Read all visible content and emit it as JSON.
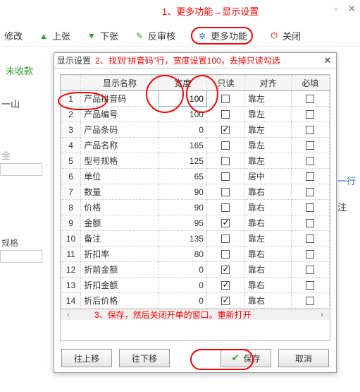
{
  "annotations": {
    "note1": "1、更多功能→显示设置",
    "note2": "2、找到“拼音码”行，宽度设置100，去掉只读勾选",
    "note3": "3、保存，然后关闭开单的窗口。重新打开"
  },
  "titlebar": {
    "min_glyph": "▫",
    "close_glyph": "✕"
  },
  "toolbar": {
    "edit": "修改",
    "prev": "上张",
    "next": "下张",
    "unaudit": "反审核",
    "more": "更多功能",
    "close": "关闭"
  },
  "background": {
    "unpaid": "未收款",
    "yishan": "一山",
    "jin": "金",
    "guige": "规格",
    "xing": "一行",
    "zhu": "注"
  },
  "dialog": {
    "title": "显示设置",
    "headers": {
      "name": "显示名称",
      "width": "宽度",
      "readonly": "只读",
      "align": "对齐",
      "required": "必填"
    },
    "rows": [
      {
        "name": "产品拼音码",
        "width": "100",
        "readonly": false,
        "align": "靠左",
        "required": false,
        "editing": true
      },
      {
        "name": "产品编号",
        "width": "100",
        "readonly": false,
        "align": "靠左",
        "required": false
      },
      {
        "name": "产品条码",
        "width": "0",
        "readonly": true,
        "align": "靠左",
        "required": false
      },
      {
        "name": "产品名称",
        "width": "165",
        "readonly": false,
        "align": "靠左",
        "required": false
      },
      {
        "name": "型号规格",
        "width": "125",
        "readonly": false,
        "align": "靠左",
        "required": false
      },
      {
        "name": "单位",
        "width": "65",
        "readonly": false,
        "align": "居中",
        "required": false
      },
      {
        "name": "数量",
        "width": "90",
        "readonly": false,
        "align": "靠右",
        "required": false
      },
      {
        "name": "价格",
        "width": "90",
        "readonly": false,
        "align": "靠右",
        "required": false
      },
      {
        "name": "金额",
        "width": "95",
        "readonly": true,
        "align": "靠右",
        "required": false
      },
      {
        "name": "备注",
        "width": "135",
        "readonly": false,
        "align": "靠左",
        "required": false
      },
      {
        "name": "折扣率",
        "width": "80",
        "readonly": false,
        "align": "靠右",
        "required": false
      },
      {
        "name": "折前金额",
        "width": "0",
        "readonly": true,
        "align": "靠右",
        "required": false
      },
      {
        "name": "折扣金额",
        "width": "0",
        "readonly": true,
        "align": "靠右",
        "required": false
      },
      {
        "name": "折后价格",
        "width": "0",
        "readonly": true,
        "align": "靠右",
        "required": false
      }
    ],
    "buttons": {
      "move_up": "往上移",
      "move_down": "往下移",
      "save": "保存",
      "cancel": "取消"
    }
  }
}
